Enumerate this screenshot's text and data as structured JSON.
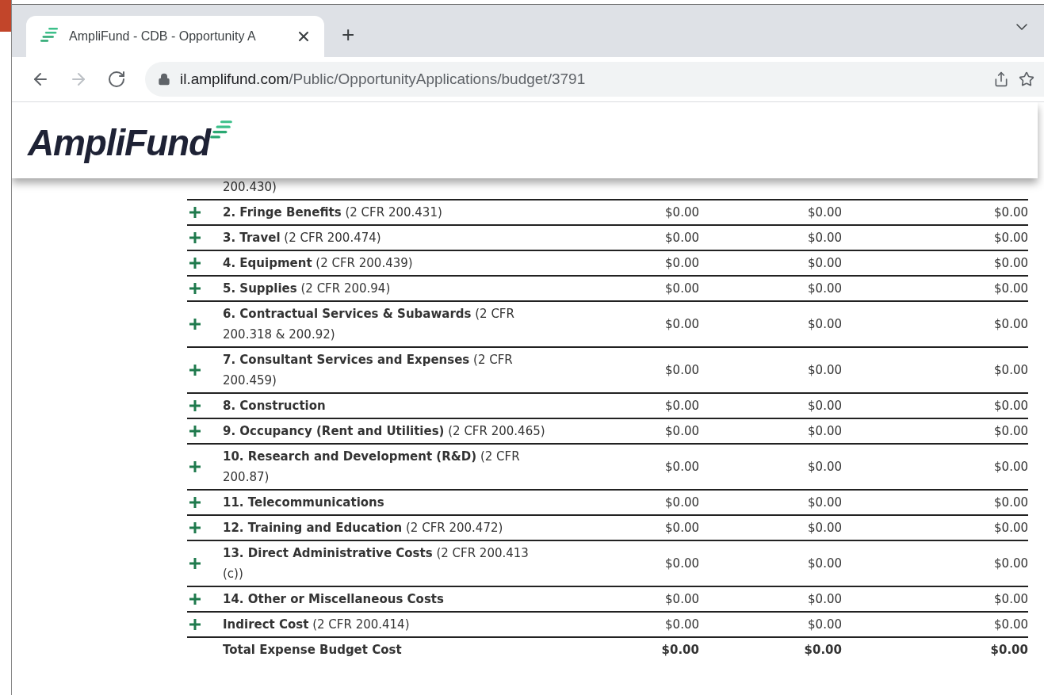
{
  "browser": {
    "tab_title": "AmpliFund - CDB - Opportunity A",
    "new_tab": "+",
    "url_host": "il.amplifund.com",
    "url_path": "/Public/OpportunityApplications/budget/3791"
  },
  "site": {
    "logo": "AmpliFund"
  },
  "budget_rows": [
    {
      "kind": "partial",
      "label": "200.430)"
    },
    {
      "kind": "category",
      "label": "**2. Fringe Benefits** (2 CFR 200.431)",
      "amounts": [
        "$0.00",
        "$0.00",
        "$0.00"
      ]
    },
    {
      "kind": "category",
      "label": "**3. Travel** (2 CFR 200.474)",
      "amounts": [
        "$0.00",
        "$0.00",
        "$0.00"
      ]
    },
    {
      "kind": "category",
      "label": "**4. Equipment** (2 CFR 200.439)",
      "amounts": [
        "$0.00",
        "$0.00",
        "$0.00"
      ]
    },
    {
      "kind": "category",
      "label": "**5. Supplies** (2 CFR 200.94)",
      "amounts": [
        "$0.00",
        "$0.00",
        "$0.00"
      ]
    },
    {
      "kind": "category",
      "label": "**6. Contractual Services & Subawards** (2 CFR 200.318 & 200.92)",
      "amounts": [
        "$0.00",
        "$0.00",
        "$0.00"
      ]
    },
    {
      "kind": "category",
      "label": "**7. Consultant Services and Expenses** (2 CFR 200.459)",
      "amounts": [
        "$0.00",
        "$0.00",
        "$0.00"
      ]
    },
    {
      "kind": "category",
      "label": "**8. Construction**",
      "amounts": [
        "$0.00",
        "$0.00",
        "$0.00"
      ]
    },
    {
      "kind": "category",
      "label": "**9. Occupancy (Rent and Utilities)** (2 CFR 200.465)",
      "amounts": [
        "$0.00",
        "$0.00",
        "$0.00"
      ]
    },
    {
      "kind": "category",
      "label": "**10. Research and Development (R&D)** (2 CFR 200.87)",
      "amounts": [
        "$0.00",
        "$0.00",
        "$0.00"
      ]
    },
    {
      "kind": "category",
      "label": "**11. Telecommunications**",
      "amounts": [
        "$0.00",
        "$0.00",
        "$0.00"
      ]
    },
    {
      "kind": "category",
      "label": "**12. Training and Education** (2 CFR 200.472)",
      "amounts": [
        "$0.00",
        "$0.00",
        "$0.00"
      ]
    },
    {
      "kind": "category",
      "label": "**13. Direct Administrative Costs** (2 CFR 200.413 (c))",
      "amounts": [
        "$0.00",
        "$0.00",
        "$0.00"
      ]
    },
    {
      "kind": "category",
      "label": "**14. Other or Miscellaneous Costs**",
      "amounts": [
        "$0.00",
        "$0.00",
        "$0.00"
      ]
    },
    {
      "kind": "category",
      "label": "**Indirect Cost** (2 CFR 200.414)",
      "amounts": [
        "$0.00",
        "$0.00",
        "$0.00"
      ]
    },
    {
      "kind": "total",
      "label": "Total Expense Budget Cost",
      "amounts": [
        "$0.00",
        "$0.00",
        "$0.00"
      ]
    }
  ]
}
